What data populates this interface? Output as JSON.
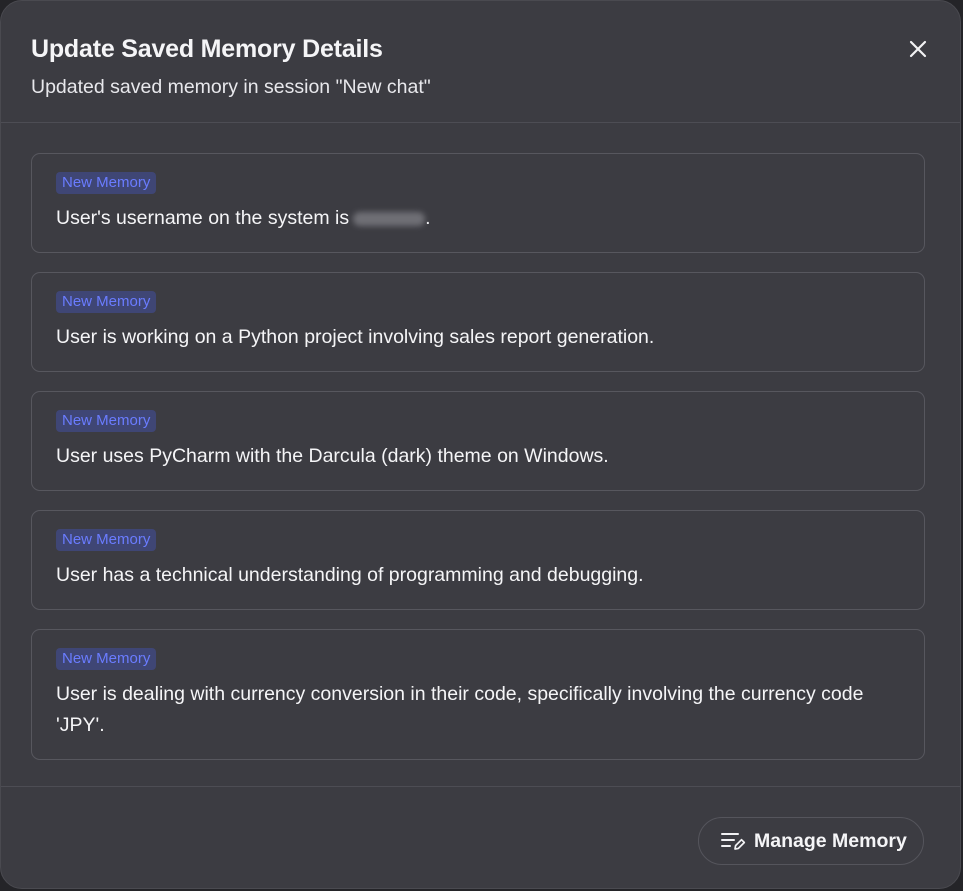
{
  "dialog": {
    "title": "Update Saved Memory Details",
    "subtitle": "Updated saved memory in session \"New chat\"",
    "close_icon": "close-icon"
  },
  "memories": [
    {
      "badge": "New Memory",
      "text": "User's username on the system is",
      "redacted": true,
      "suffix": "."
    },
    {
      "badge": "New Memory",
      "text": "User is working on a Python project involving sales report generation."
    },
    {
      "badge": "New Memory",
      "text": "User uses PyCharm with the Darcula (dark) theme on Windows."
    },
    {
      "badge": "New Memory",
      "text": "User has a technical understanding of programming and debugging."
    },
    {
      "badge": "New Memory",
      "text": "User is dealing with currency conversion in their code, specifically involving the currency code 'JPY'."
    }
  ],
  "footer": {
    "manage_label": "Manage Memory",
    "manage_icon": "list-edit-icon"
  },
  "colors": {
    "background": "#3c3c42",
    "badge_bg": "#3f4675",
    "badge_text": "#6a7cff",
    "text": "#f5f5f7"
  }
}
